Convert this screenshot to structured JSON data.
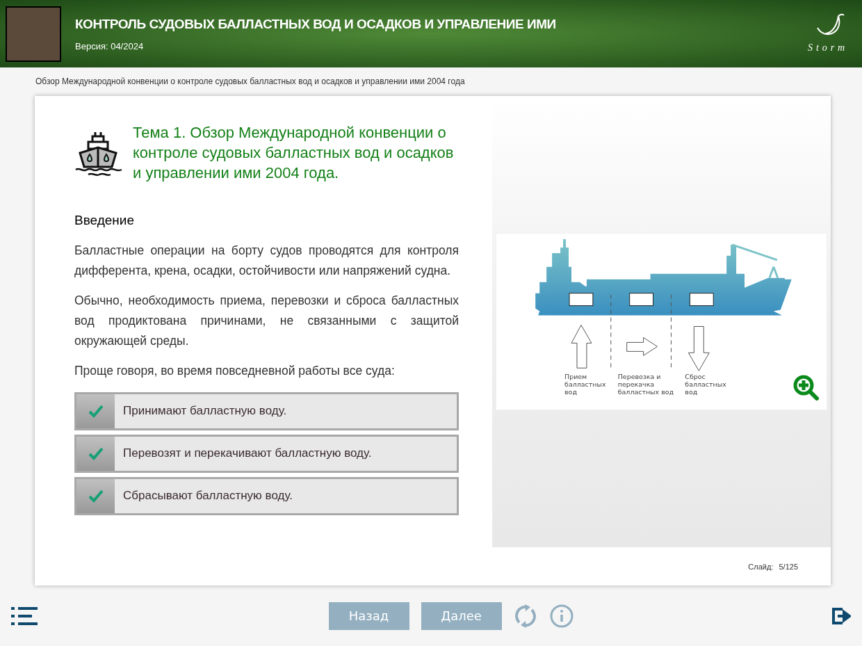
{
  "header": {
    "title": "КОНТРОЛЬ СУДОВЫХ БАЛЛАСТНЫХ ВОД И ОСАДКОВ И УПРАВЛЕНИЕ ИМИ",
    "version": "Версия: 04/2024",
    "logo_text": "Storm"
  },
  "breadcrumb": "Обзор Международной конвенции о контроле судовых балластных вод и осадков и управлении ими 2004 года",
  "slide": {
    "topic_title": "Тема 1. Обзор Международной конвенции о контроле судовых балластных вод и осадков и управлении ими 2004 года.",
    "section_heading": "Введение",
    "paragraphs": [
      "Балластные операции на борту судов проводятся для контроля дифферента, крена, осадки, остойчивости или напряжений судна.",
      "Обычно, необходимость приема, перевозки и сброса балластных вод продиктована причинами, не связанными с защитой окружающей среды.",
      "Проще говоря, во время повседневной работы все суда:"
    ],
    "checklist": [
      {
        "text": "Принимают балластную воду.",
        "checked": true
      },
      {
        "text": "Перевозят и перекачивают балластную воду.",
        "checked": true
      },
      {
        "text": "Сбрасывают балластную воду.",
        "checked": true
      }
    ],
    "diagram_labels": [
      [
        "Прием",
        "балластных",
        "вод"
      ],
      [
        "Перевозка и",
        "перекачка",
        "балластных вод"
      ],
      [
        "Сброс",
        "балластных",
        "вод"
      ]
    ],
    "counter": {
      "label": "Слайд:",
      "value": "5/125"
    }
  },
  "footer": {
    "buttons": [
      "Назад",
      "Далее"
    ]
  }
}
